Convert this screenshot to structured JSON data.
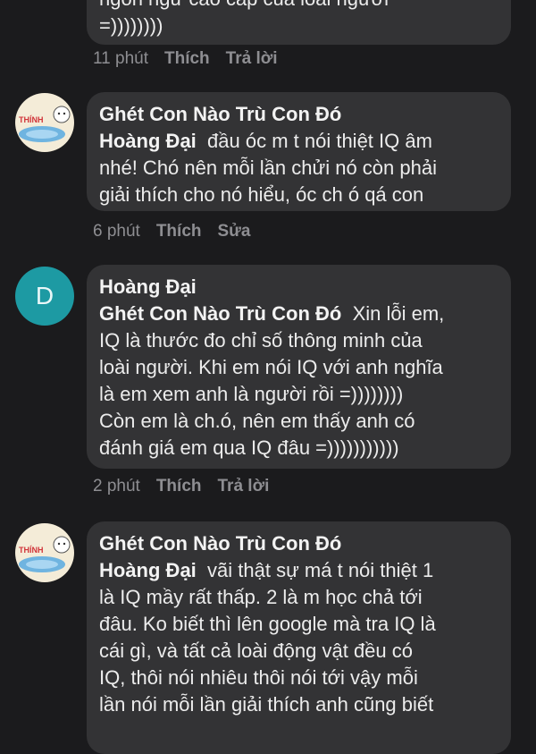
{
  "comments": [
    {
      "text_partial": "ngôn ngữ cao cấp của loài người",
      "text_end": "=))))))))",
      "time": "11 phút",
      "actions": [
        "Thích",
        "Trả lời"
      ]
    },
    {
      "author": "Ghét Con Nào Trù Con Đó",
      "avatar_label": "THÍNH",
      "mention": "Hoàng Đại",
      "lines": [
        "đầu óc m t nói thiệt IQ âm",
        "nhé! Chó nên mỗi lần chửi nó còn phải",
        "giải thích cho nó hiểu, óc ch ó qá con"
      ],
      "time": "6 phút",
      "actions": [
        "Thích",
        "Sửa"
      ]
    },
    {
      "author": "Hoàng Đại",
      "avatar_letter": "D",
      "mention": "Ghét Con Nào Trù Con Đó",
      "lines": [
        "Xin lỗi em,",
        "IQ là thước đo chỉ số thông minh của",
        "loài người. Khi em nói IQ với anh nghĩa",
        "là em xem anh là người rồi =))))))))",
        "Còn em là ch.ó, nên em thấy anh có",
        "đánh giá em qua IQ đâu =)))))))))))"
      ],
      "time": "2 phút",
      "actions": [
        "Thích",
        "Trả lời"
      ]
    },
    {
      "author": "Ghét Con Nào Trù Con Đó",
      "avatar_label": "THÍNH",
      "mention": "Hoàng Đại",
      "lines": [
        "vãi thật sự má t nói thiệt 1",
        "là IQ mầy rất thấp. 2 là m học chả tới",
        "đâu. Ko biết thì lên google mà tra IQ là",
        "cái gì, và tất cả loài động vật đều có",
        "IQ, thôi nói nhiêu thôi nói tới vậy mỗi",
        "lần nói mỗi lần giải thích anh cũng biết"
      ]
    }
  ],
  "colors": {
    "background": "#1b1b1d",
    "bubble": "#333335",
    "meta_text": "#8e8e92",
    "avatar_d": "#1d9aa3"
  }
}
